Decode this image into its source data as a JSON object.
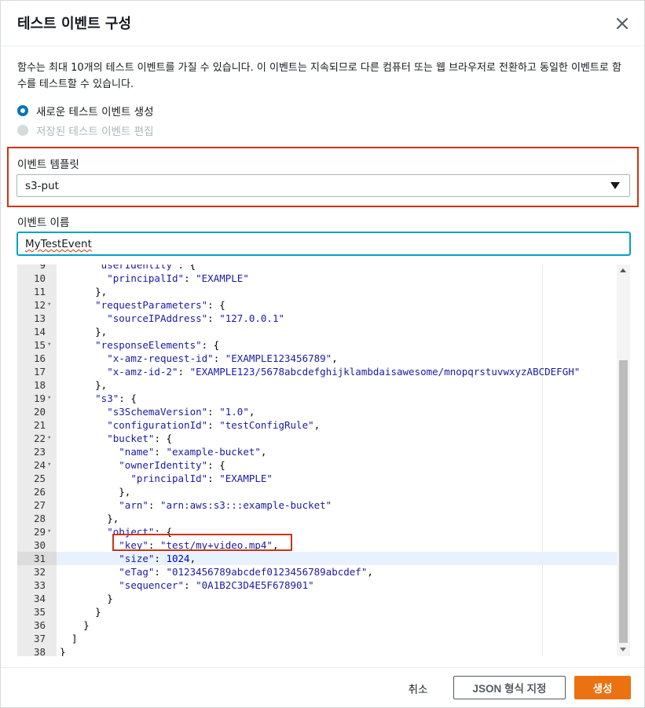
{
  "dialog": {
    "title": "테스트 이벤트 구성",
    "description": "함수는 최대 10개의 테스트 이벤트를 가질 수 있습니다. 이 이벤트는 지속되므로 다른 컴퓨터 또는 웹 브라우저로 전환하고 동일한 이벤트로 함수를 테스트할 수 있습니다.",
    "close_icon": "close-icon"
  },
  "options": {
    "new_event": "새로운 테스트 이벤트 생성",
    "edit_saved": "저장된 테스트 이벤트 편집",
    "selected": "new_event"
  },
  "template": {
    "label": "이벤트 템플릿",
    "value": "s3-put"
  },
  "event_name": {
    "label": "이벤트 이름",
    "value": "MyTestEvent"
  },
  "editor": {
    "active_line": 31,
    "lines": [
      {
        "n": "9",
        "text": "      \"userIdentity\": {",
        "fold": false
      },
      {
        "n": "10",
        "text": "        \"principalId\": \"EXAMPLE\"",
        "fold": false
      },
      {
        "n": "11",
        "text": "      },",
        "fold": false
      },
      {
        "n": "12",
        "text": "      \"requestParameters\": {",
        "fold": true
      },
      {
        "n": "13",
        "text": "        \"sourceIPAddress\": \"127.0.0.1\"",
        "fold": false
      },
      {
        "n": "14",
        "text": "      },",
        "fold": false
      },
      {
        "n": "15",
        "text": "      \"responseElements\": {",
        "fold": true
      },
      {
        "n": "16",
        "text": "        \"x-amz-request-id\": \"EXAMPLE123456789\",",
        "fold": false
      },
      {
        "n": "17",
        "text": "        \"x-amz-id-2\": \"EXAMPLE123/5678abcdefghijklambdaisawesome/mnopqrstuvwxyzABCDEFGH\"",
        "fold": false
      },
      {
        "n": "18",
        "text": "      },",
        "fold": false
      },
      {
        "n": "19",
        "text": "      \"s3\": {",
        "fold": true
      },
      {
        "n": "20",
        "text": "        \"s3SchemaVersion\": \"1.0\",",
        "fold": false
      },
      {
        "n": "21",
        "text": "        \"configurationId\": \"testConfigRule\",",
        "fold": false
      },
      {
        "n": "22",
        "text": "        \"bucket\": {",
        "fold": true
      },
      {
        "n": "23",
        "text": "          \"name\": \"example-bucket\",",
        "fold": false
      },
      {
        "n": "24",
        "text": "          \"ownerIdentity\": {",
        "fold": true
      },
      {
        "n": "25",
        "text": "            \"principalId\": \"EXAMPLE\"",
        "fold": false
      },
      {
        "n": "26",
        "text": "          },",
        "fold": false
      },
      {
        "n": "27",
        "text": "          \"arn\": \"arn:aws:s3:::example-bucket\"",
        "fold": false
      },
      {
        "n": "28",
        "text": "        },",
        "fold": false
      },
      {
        "n": "29",
        "text": "        \"object\": {",
        "fold": true
      },
      {
        "n": "30",
        "text": "          \"key\": \"test/my+video.mp4\",",
        "fold": false
      },
      {
        "n": "31",
        "text": "          \"size\": 1024,",
        "fold": false
      },
      {
        "n": "32",
        "text": "          \"eTag\": \"0123456789abcdef0123456789abcdef\",",
        "fold": false
      },
      {
        "n": "33",
        "text": "          \"sequencer\": \"0A1B2C3D4E5F678901\"",
        "fold": false
      },
      {
        "n": "34",
        "text": "        }",
        "fold": false
      },
      {
        "n": "35",
        "text": "      }",
        "fold": false
      },
      {
        "n": "36",
        "text": "    }",
        "fold": false
      },
      {
        "n": "37",
        "text": "  ]",
        "fold": false
      },
      {
        "n": "38",
        "text": "}",
        "fold": false
      }
    ]
  },
  "footer": {
    "cancel": "취소",
    "format_json": "JSON 형식 지정",
    "create": "생성"
  },
  "colors": {
    "primary": "#ec7211",
    "radio_selected": "#0073bb",
    "focus": "#00a1c9",
    "highlight_box": "#d13212"
  }
}
